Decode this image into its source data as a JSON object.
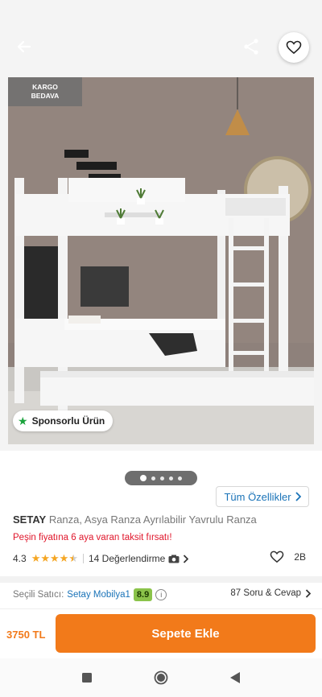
{
  "product_image": {
    "badge_kargo_line1": "KARGO",
    "badge_kargo_line2": "BEDAVA",
    "sponsored_label": "Sponsorlu Ürün"
  },
  "carousel": {
    "total_dots": 5,
    "active_index": 0
  },
  "all_features_label": "Tüm Özellikler",
  "product": {
    "brand": "SETAY",
    "name": "Ranza, Asya Ranza Ayrılabilir Yavrulu Ranza",
    "installment_text": "Peşin fiyatına 6 aya varan taksit fırsatı!",
    "rating": "4.3",
    "stars_display": "★★★★★",
    "review_count_text": "14 Değerlendirme",
    "favorite_count": "2B"
  },
  "seller": {
    "label": "Seçili Satıcı:",
    "name": "Setay Mobilya1",
    "score": "8.9",
    "qa_text": "87 Soru & Cevap"
  },
  "bottom": {
    "price": "3750 TL",
    "add_to_cart": "Sepete Ekle"
  },
  "colors": {
    "accent": "#f27a1a",
    "link": "#1a73b8",
    "seller_score": "#8bc34a",
    "installment": "#e0162b",
    "star": "#f5a623"
  }
}
